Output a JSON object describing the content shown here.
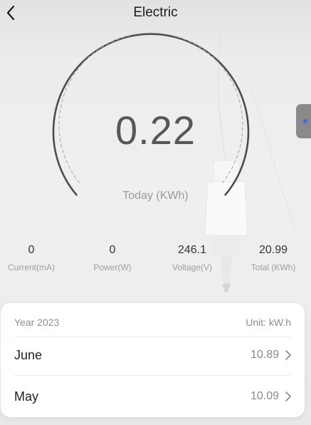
{
  "header": {
    "title": "Electric",
    "back_icon": "chevron-left-icon"
  },
  "gauge": {
    "value": "0.22",
    "label": "Today (KWh)"
  },
  "side_tab": {
    "icon": "blue-dot-icon",
    "dot_color": "#3f6ce0"
  },
  "stats": [
    {
      "value": "0",
      "label": "Current(mA)"
    },
    {
      "value": "0",
      "label": "Power(W)"
    },
    {
      "value": "246.1",
      "label": "Voltage(V)"
    },
    {
      "value": "20.99",
      "label": "Total (KWh)"
    }
  ],
  "history": {
    "year": "Year 2023",
    "unit": "Unit: kW.h",
    "rows": [
      {
        "month": "June",
        "value": "10.89"
      },
      {
        "month": "May",
        "value": "10.09"
      }
    ]
  }
}
